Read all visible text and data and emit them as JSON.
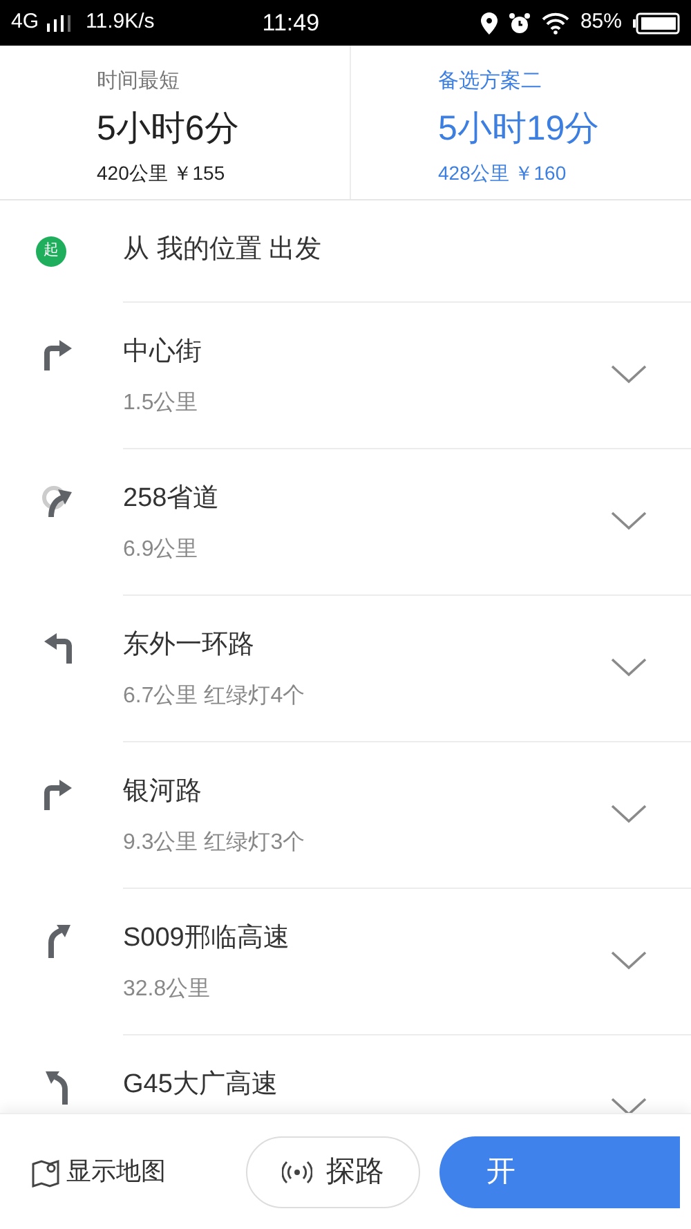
{
  "status_bar": {
    "network": "4G",
    "speed": "11.9K/s",
    "time": "11:49",
    "battery": "85%"
  },
  "routes": [
    {
      "label": "时间最短",
      "duration": "5小时6分",
      "detail": "420公里 ￥155",
      "selected": false
    },
    {
      "label": "备选方案二",
      "duration": "5小时19分",
      "detail": "428公里 ￥160",
      "selected": true
    }
  ],
  "start": {
    "badge": "起",
    "text": "从 我的位置 出发"
  },
  "steps": [
    {
      "kind": "right",
      "road": "中心街",
      "detail": "1.5公里"
    },
    {
      "kind": "uturn-right",
      "road": "258省道",
      "detail": "6.9公里"
    },
    {
      "kind": "left",
      "road": "东外一环路",
      "detail": "6.7公里 红绿灯4个"
    },
    {
      "kind": "right",
      "road": "银河路",
      "detail": "9.3公里 红绿灯3个"
    },
    {
      "kind": "bear-right",
      "road": "S009邢临高速",
      "detail": "32.8公里"
    },
    {
      "kind": "bear-left",
      "road": "G45大广高速"
    }
  ],
  "bottom_bar": {
    "map_label": "显示地图",
    "probe_label": "探路",
    "start_label": "开"
  }
}
